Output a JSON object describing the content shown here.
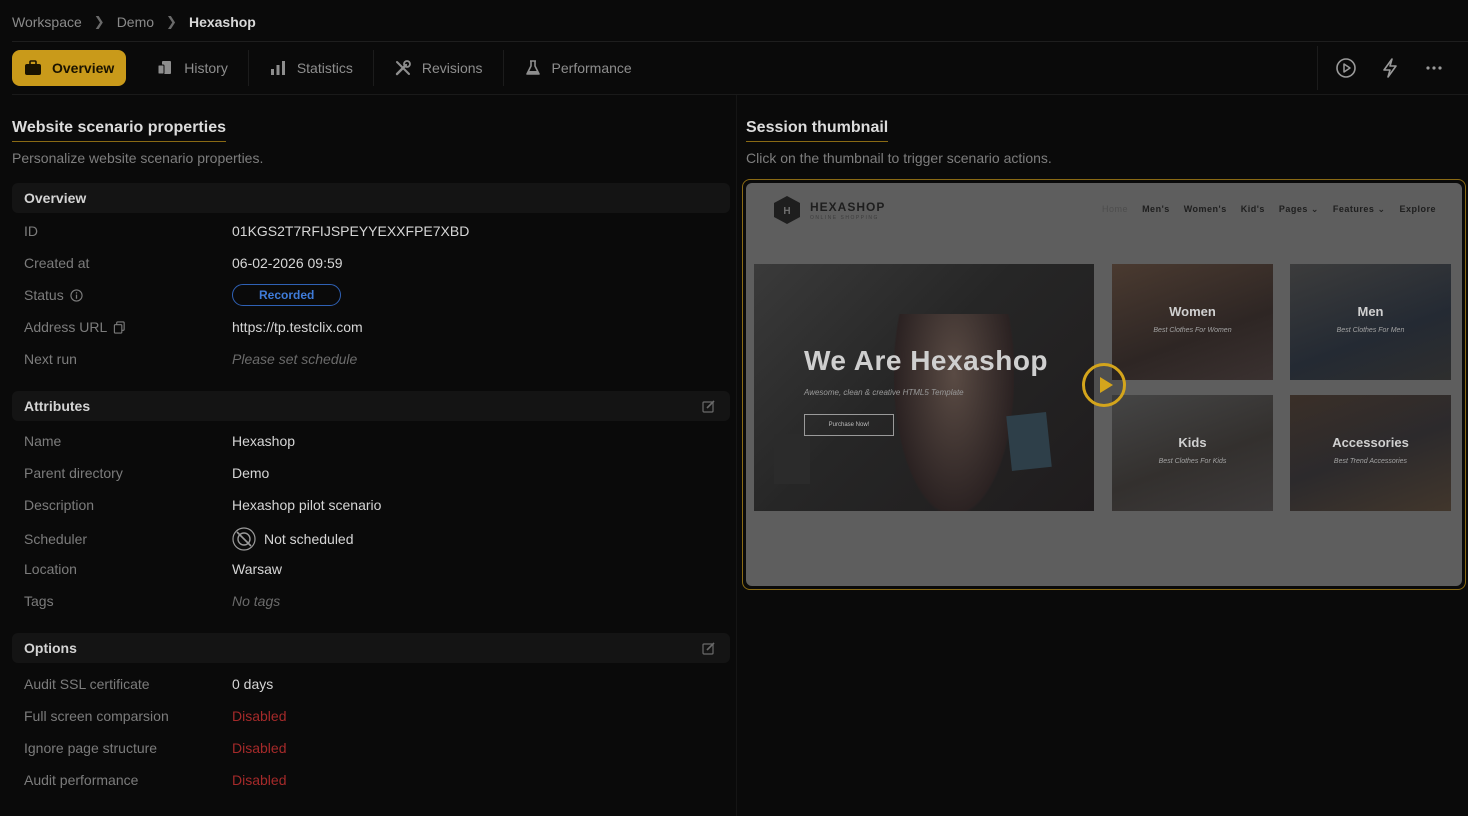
{
  "breadcrumb": {
    "items": [
      "Workspace",
      "Demo"
    ],
    "current": "Hexashop"
  },
  "tabs": [
    {
      "label": "Overview",
      "icon": "briefcase-icon",
      "active": true
    },
    {
      "label": "History",
      "icon": "history-icon"
    },
    {
      "label": "Statistics",
      "icon": "bar-chart-icon"
    },
    {
      "label": "Revisions",
      "icon": "tools-icon"
    },
    {
      "label": "Performance",
      "icon": "flask-icon"
    }
  ],
  "actions": [
    "play-circle-icon",
    "lightning-icon",
    "more-icon"
  ],
  "properties": {
    "title": "Website scenario properties",
    "subtitle": "Personalize website scenario properties.",
    "overview": {
      "header": "Overview",
      "id_label": "ID",
      "id_value": "01KGS2T7RFIJSPEYYEXXFPE7XBD",
      "created_label": "Created at",
      "created_value": "06-02-2026 09:59",
      "status_label": "Status",
      "status_value": "Recorded",
      "url_label": "Address URL",
      "url_value": "https://tp.testclix.com",
      "next_run_label": "Next run",
      "next_run_value": "Please set schedule"
    },
    "attributes": {
      "header": "Attributes",
      "name_label": "Name",
      "name_value": "Hexashop",
      "parent_label": "Parent directory",
      "parent_value": "Demo",
      "description_label": "Description",
      "description_value": "Hexashop pilot scenario",
      "scheduler_label": "Scheduler",
      "scheduler_value": "Not scheduled",
      "location_label": "Location",
      "location_value": "Warsaw",
      "tags_label": "Tags",
      "tags_value": "No tags"
    },
    "options": {
      "header": "Options",
      "ssl_label": "Audit SSL certificate",
      "ssl_value": "0 days",
      "fullscreen_label": "Full screen comparsion",
      "fullscreen_value": "Disabled",
      "ignore_label": "Ignore page structure",
      "ignore_value": "Disabled",
      "perf_label": "Audit performance",
      "perf_value": "Disabled"
    }
  },
  "thumbnail": {
    "title": "Session thumbnail",
    "subtitle": "Click on the thumbnail to trigger scenario actions.",
    "site": {
      "logo_letter": "H",
      "logo_name": "HEXASHOP",
      "logo_tagline": "ONLINE SHOPPING",
      "nav": [
        "Home",
        "Men's",
        "Women's",
        "Kid's",
        "Pages ⌄",
        "Features ⌄",
        "Explore"
      ],
      "hero_title": "We Are Hexashop",
      "hero_sub": "Awesome, clean & creative HTML5 Template",
      "hero_button": "Purchase Now!",
      "tiles": [
        {
          "title": "Women",
          "sub": "Best Clothes For Women"
        },
        {
          "title": "Men",
          "sub": "Best Clothes For Men"
        },
        {
          "title": "Kids",
          "sub": "Best Clothes For Kids"
        },
        {
          "title": "Accessories",
          "sub": "Best Trend Accessories"
        }
      ]
    }
  },
  "colors": {
    "accent": "#c99a1a",
    "status_blue": "#3f7bd8",
    "disabled_red": "#a52a2a"
  }
}
